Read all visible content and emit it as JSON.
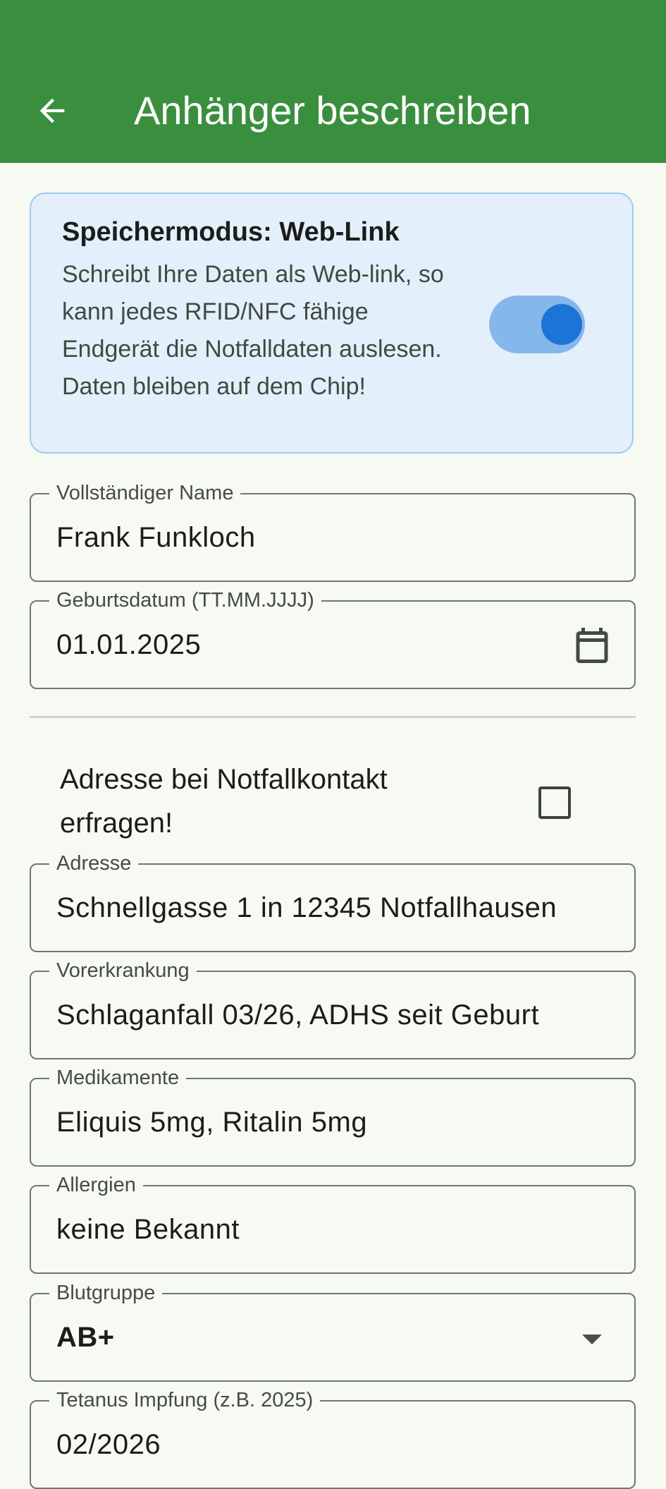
{
  "appbar": {
    "title": "Anhänger beschreiben",
    "back_icon": "arrow-left-icon",
    "background": "#3a8f3e"
  },
  "storage_mode": {
    "title": "Speichermodus: Web-Link",
    "description": "Schreibt Ihre Daten als Web-link, so kann jedes RFID/NFC fähige Endgerät die Notfalldaten auslesen. Daten bleiben auf dem Chip!",
    "toggle_on": true,
    "accent": "#1c74d6"
  },
  "fields": {
    "name": {
      "label": "Vollständiger Name",
      "value": "Frank Funkloch"
    },
    "birthdate": {
      "label": "Geburtsdatum (TT.MM.JJJJ)",
      "value": "01.01.2025",
      "icon": "calendar-icon"
    },
    "address_checkbox": {
      "label": "Adresse bei Notfallkontakt erfragen!",
      "checked": false
    },
    "address": {
      "label": "Adresse",
      "value": "Schnellgasse 1 in 12345 Notfallhausen"
    },
    "condition": {
      "label": "Vorerkrankung",
      "value": "Schlaganfall 03/26, ADHS seit Geburt"
    },
    "medication": {
      "label": "Medikamente",
      "value": "Eliquis 5mg, Ritalin 5mg"
    },
    "allergies": {
      "label": "Allergien",
      "value": "keine Bekannt"
    },
    "blood_type": {
      "label": "Blutgruppe",
      "value": "AB+"
    },
    "tetanus": {
      "label": "Tetanus Impfung (z.B. 2025)",
      "value": "02/2026"
    }
  }
}
